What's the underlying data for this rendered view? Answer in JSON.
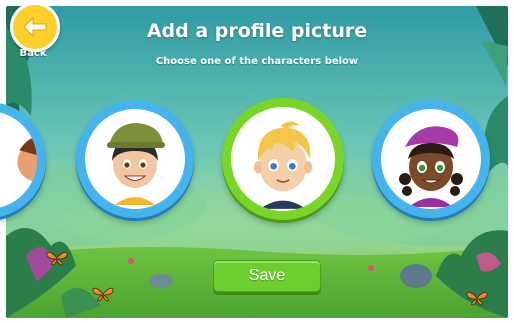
{
  "header": {
    "back_label": "Back",
    "title": "Add a profile picture",
    "subtitle": "Choose one of the characters below"
  },
  "characters": [
    {
      "name": "partial-left-character",
      "selected": false
    },
    {
      "name": "boy-green-hat",
      "selected": false
    },
    {
      "name": "blond-boy",
      "selected": true
    },
    {
      "name": "girl-purple-beret",
      "selected": false
    }
  ],
  "actions": {
    "save_label": "Save"
  },
  "colors": {
    "ring_default": "#45b4ec",
    "ring_selected": "#7ad626",
    "save_button": "#6ccf2f",
    "back_button": "#ffd02c",
    "sky_top": "#3fa7a8",
    "grass": "#5fbc3a"
  },
  "icons": {
    "back": "arrow-left-icon",
    "butterfly": "butterfly-icon"
  }
}
